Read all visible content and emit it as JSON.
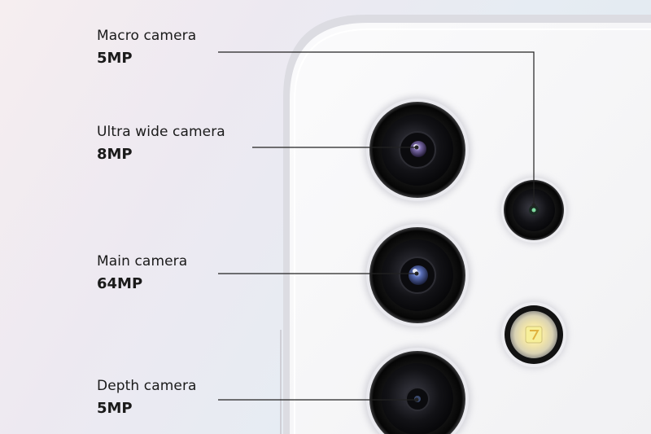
{
  "cameras": [
    {
      "name": "Macro camera",
      "mp": "5MP"
    },
    {
      "name": "Ultra wide camera",
      "mp": "8MP"
    },
    {
      "name": "Main camera",
      "mp": "64MP"
    },
    {
      "name": "Depth camera",
      "mp": "5MP"
    }
  ],
  "colors": {
    "phone_body": "#f7f7f8",
    "phone_frame": "#e4e4e8",
    "lens_black": "#111111",
    "leader_line": "#222222",
    "flash_yellow": "#f4d36b"
  }
}
